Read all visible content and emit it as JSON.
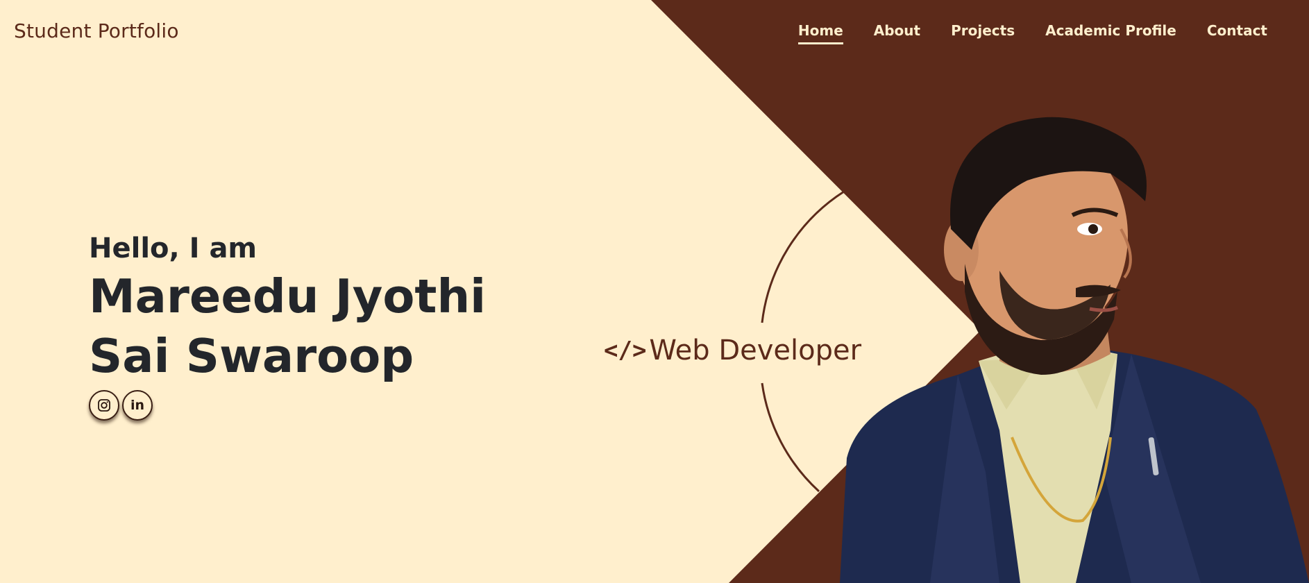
{
  "header": {
    "logo": "Student Portfolio",
    "nav": [
      {
        "label": "Home",
        "active": true
      },
      {
        "label": "About",
        "active": false
      },
      {
        "label": "Projects",
        "active": false
      },
      {
        "label": "Academic Profile",
        "active": false
      },
      {
        "label": "Contact",
        "active": false
      }
    ]
  },
  "hero": {
    "greeting": "Hello, I am",
    "name_line1": "Mareedu Jyothi",
    "name_line2": "Sai Swaroop",
    "role": "Web Developer",
    "socials": [
      {
        "icon": "instagram-icon"
      },
      {
        "icon": "linkedin-icon",
        "label": "in"
      }
    ]
  },
  "colors": {
    "cream": "#FFEFCD",
    "brown": "#5C2A1A",
    "dark_text": "#23262B"
  }
}
